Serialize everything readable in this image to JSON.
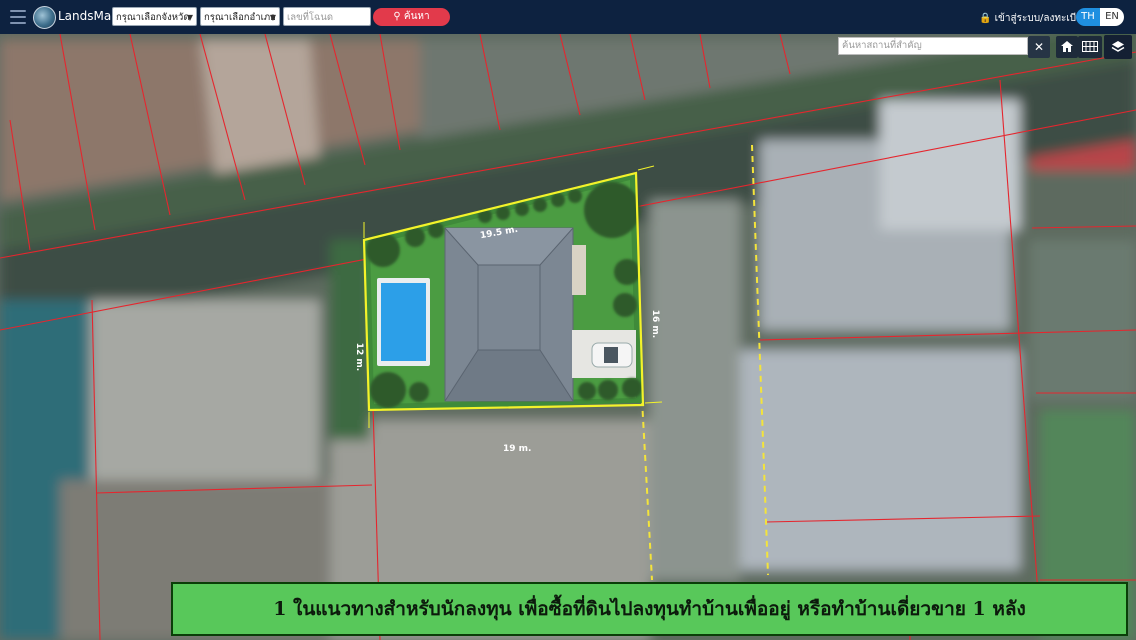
{
  "app": {
    "brand": "LandsMaps"
  },
  "header": {
    "province_select": "กรุณาเลือกจังหวัด",
    "amphoe_select": "กรุณาเลือกอำเภอ",
    "deed_placeholder": "เลขที่โฉนด",
    "search_label": "ค้นหา",
    "login_label": "เข้าสู่ระบบ/ลงทะเบียน",
    "lang_th": "TH",
    "lang_en": "EN"
  },
  "map": {
    "place_search_placeholder": "ค้นหาสถานที่สำคัญ",
    "icons": {
      "close": "close-icon",
      "home": "home-icon",
      "grid": "grid-icon",
      "layers": "layers-icon"
    },
    "plot": {
      "dim_top": "19.5 m.",
      "dim_bottom": "19 m.",
      "dim_left": "12 m.",
      "dim_right": "16 m."
    }
  },
  "caption": "1 ในแนวทางสำหรับนักลงทุน เพื่อซื้อที่ดินไปลงทุนทำบ้านเพื่ออยู่ หรือทำบ้านเดี่ยวขาย 1 หลัง",
  "colors": {
    "topbar": "#0d2240",
    "search_button": "#e23a4b",
    "caption_bg": "#58c85a",
    "parcel_lines": "#e5262e",
    "plot_outline": "#f3f32a"
  }
}
